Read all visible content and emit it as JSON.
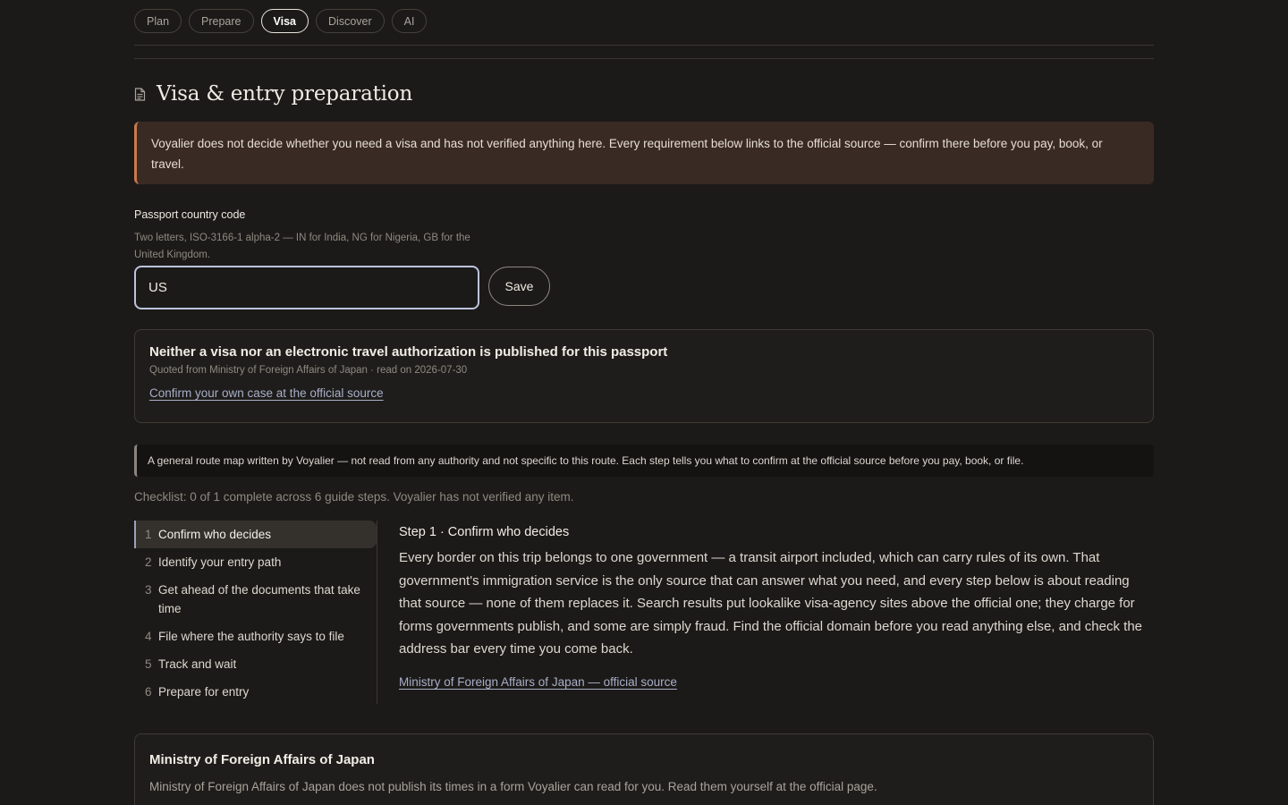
{
  "nav": {
    "tabs": [
      {
        "label": "Plan",
        "active": false
      },
      {
        "label": "Prepare",
        "active": false
      },
      {
        "label": "Visa",
        "active": true
      },
      {
        "label": "Discover",
        "active": false
      },
      {
        "label": "AI",
        "active": false
      }
    ]
  },
  "header": {
    "title": "Visa & entry preparation",
    "icon": "document-icon"
  },
  "disclaimer": {
    "text": "Voyalier does not decide whether you need a visa and has not verified anything here. Every requirement below links to the official source — confirm there before you pay, book, or travel."
  },
  "passport": {
    "label": "Passport country code",
    "help": "Two letters, ISO-3166-1 alpha-2 — IN for India, NG for Nigeria, GB for the United Kingdom.",
    "value": "US",
    "save_label": "Save"
  },
  "result": {
    "title": "Neither a visa nor an electronic travel authorization is published for this passport",
    "meta": "Quoted from Ministry of Foreign Affairs of Japan · read on 2026-07-30",
    "link": "Confirm your own case at the official source"
  },
  "route_note": {
    "text": "A general route map written by Voyalier — not read from any authority and not specific to this route. Each step tells you what to confirm at the official source before you pay, book, or file."
  },
  "checklist": {
    "summary": "Checklist: 0 of 1 complete across 6 guide steps. Voyalier has not verified any item."
  },
  "steps": [
    {
      "num": "1",
      "label": "Confirm who decides",
      "active": true
    },
    {
      "num": "2",
      "label": "Identify your entry path",
      "active": false
    },
    {
      "num": "3",
      "label": "Get ahead of the documents that take time",
      "active": false
    },
    {
      "num": "4",
      "label": "File where the authority says to file",
      "active": false
    },
    {
      "num": "5",
      "label": "Track and wait",
      "active": false
    },
    {
      "num": "6",
      "label": "Prepare for entry",
      "active": false
    }
  ],
  "detail": {
    "title": "Step 1 · Confirm who decides",
    "body": "Every border on this trip belongs to one government — a transit airport included, which can carry rules of its own. That government's immigration service is the only source that can answer what you need, and every step below is about reading that source — none of them replaces it. Search results put lookalike visa-agency sites above the official one; they charge for forms governments publish, and some are simply fraud. Find the official domain before you read anything else, and check the address bar every time you come back.",
    "link": "Ministry of Foreign Affairs of Japan — official source"
  },
  "authority": {
    "title": "Ministry of Foreign Affairs of Japan",
    "body": "Ministry of Foreign Affairs of Japan does not publish its times in a form Voyalier can read for you. Read them yourself at the official page."
  },
  "colors": {
    "background": "#1c1a18",
    "disclaimer_bg": "#3a2a24",
    "disclaimer_accent": "#c9794f",
    "link": "#a7aec8"
  }
}
